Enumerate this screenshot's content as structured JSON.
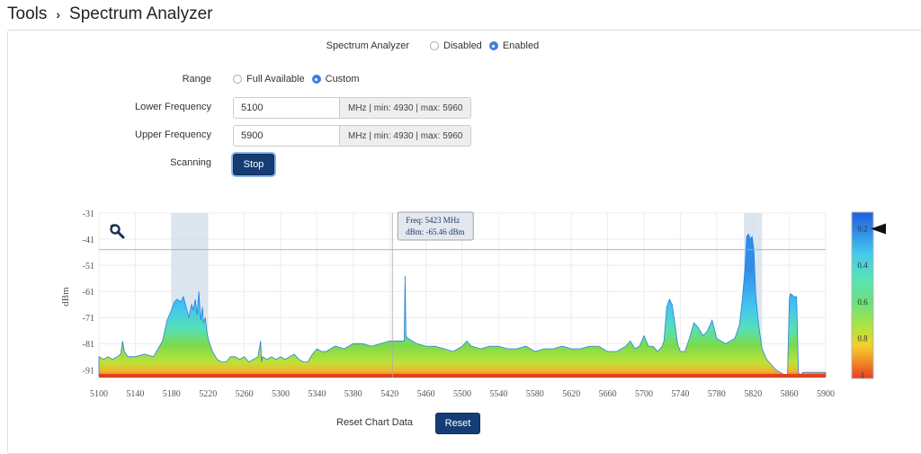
{
  "breadcrumb": {
    "root": "Tools",
    "current": "Spectrum Analyzer"
  },
  "form": {
    "analyzer": {
      "label": "Spectrum Analyzer",
      "options": [
        "Disabled",
        "Enabled"
      ],
      "selected": "Enabled"
    },
    "range": {
      "label": "Range",
      "options": [
        "Full Available",
        "Custom"
      ],
      "selected": "Custom"
    },
    "lower": {
      "label": "Lower Frequency",
      "value": "5100",
      "addon": "MHz | min: 4930 | max: 5960"
    },
    "upper": {
      "label": "Upper Frequency",
      "value": "5900",
      "addon": "MHz | min: 4930 | max: 5960"
    },
    "scanning": {
      "label": "Scanning",
      "button": "Stop"
    }
  },
  "chart_data": {
    "type": "area",
    "ylabel": "dBm",
    "xlim": [
      5100,
      5900
    ],
    "ylim": [
      -94,
      -31
    ],
    "x_ticks": [
      5100,
      5140,
      5180,
      5220,
      5260,
      5300,
      5340,
      5380,
      5420,
      5460,
      5500,
      5540,
      5580,
      5620,
      5660,
      5700,
      5740,
      5780,
      5820,
      5860,
      5900
    ],
    "y_ticks": [
      -31,
      -41,
      -51,
      -61,
      -71,
      -81,
      -91
    ],
    "tooltip": {
      "freq": "Freq: 5423 MHz",
      "dbm": "dBm: -65.46 dBm"
    },
    "crosshair": {
      "x": 5423,
      "y": -45
    },
    "highlight_bands": [
      [
        5180,
        5220
      ],
      [
        5810,
        5830
      ]
    ],
    "series": [
      {
        "x": [
          5100,
          5105,
          5110,
          5115,
          5120,
          5124,
          5126,
          5128,
          5132,
          5140,
          5150,
          5160,
          5170,
          5175,
          5180,
          5183,
          5186,
          5190,
          5193,
          5196,
          5199,
          5202,
          5204,
          5206,
          5208,
          5210,
          5212,
          5214,
          5215,
          5217,
          5219,
          5221,
          5223,
          5225,
          5230,
          5235,
          5240,
          5245,
          5250,
          5255,
          5260,
          5265,
          5270,
          5275,
          5278,
          5279,
          5280,
          5285,
          5290,
          5295,
          5300,
          5305,
          5310,
          5315,
          5320,
          5325,
          5330,
          5335,
          5340,
          5345,
          5350,
          5360,
          5370,
          5380,
          5390,
          5400,
          5410,
          5420,
          5430,
          5436,
          5437,
          5438,
          5440,
          5445,
          5450,
          5460,
          5470,
          5480,
          5490,
          5495,
          5500,
          5505,
          5510,
          5520,
          5530,
          5540,
          5550,
          5560,
          5570,
          5580,
          5590,
          5600,
          5610,
          5620,
          5630,
          5640,
          5650,
          5660,
          5670,
          5680,
          5685,
          5690,
          5695,
          5700,
          5705,
          5710,
          5715,
          5720,
          5722,
          5725,
          5728,
          5731,
          5734,
          5737,
          5740,
          5745,
          5750,
          5755,
          5760,
          5765,
          5770,
          5775,
          5780,
          5785,
          5790,
          5795,
          5800,
          5805,
          5808,
          5811,
          5813,
          5815,
          5817,
          5819,
          5821,
          5823,
          5825,
          5827,
          5830,
          5835,
          5840,
          5845,
          5850,
          5855,
          5858,
          5860,
          5861,
          5862,
          5865,
          5868,
          5870,
          5872,
          5875,
          5880,
          5885,
          5890,
          5900
        ],
        "y": [
          -86,
          -87,
          -86,
          -87,
          -86,
          -85,
          -80,
          -84,
          -86,
          -86,
          -85,
          -86,
          -80,
          -72,
          -68,
          -65,
          -64,
          -65,
          -63,
          -67,
          -71,
          -66,
          -68,
          -64,
          -70,
          -61,
          -72,
          -67,
          -73,
          -71,
          -77,
          -80,
          -82,
          -84,
          -87,
          -88,
          -88,
          -86,
          -86,
          -87,
          -86,
          -88,
          -87,
          -86,
          -80,
          -88,
          -86,
          -87,
          -86,
          -87,
          -86,
          -87,
          -86,
          -85,
          -87,
          -88,
          -88,
          -85,
          -83,
          -84,
          -84,
          -82,
          -83,
          -81,
          -81,
          -82,
          -81,
          -80,
          -80,
          -80,
          -55,
          -78,
          -79,
          -80,
          -81,
          -82,
          -82,
          -83,
          -84,
          -83,
          -82,
          -80,
          -82,
          -83,
          -82,
          -82,
          -83,
          -83,
          -82,
          -84,
          -83,
          -83,
          -82,
          -83,
          -83,
          -82,
          -82,
          -84,
          -84,
          -82,
          -80,
          -83,
          -82,
          -78,
          -82,
          -82,
          -84,
          -82,
          -80,
          -67,
          -64,
          -66,
          -73,
          -81,
          -84,
          -84,
          -79,
          -73,
          -75,
          -78,
          -76,
          -72,
          -79,
          -80,
          -81,
          -80,
          -79,
          -74,
          -65,
          -53,
          -40,
          -39,
          -41,
          -40,
          -45,
          -62,
          -70,
          -76,
          -83,
          -87,
          -89,
          -91,
          -92,
          -93,
          -93,
          -64,
          -62,
          -62,
          -63,
          -63,
          -92,
          -93,
          -92,
          -92,
          -92,
          -92,
          -92
        ]
      }
    ],
    "colorbar": {
      "labels": [
        "0.2",
        "0.4",
        "0.6",
        "0.8",
        "1"
      ],
      "marker": 0.2
    }
  },
  "footer": {
    "reset_label": "Reset Chart Data",
    "reset_button": "Reset"
  },
  "colors": {
    "button": "#153d75",
    "radio_on": "#3b82e0"
  },
  "icons": {
    "zoom": "zoom-icon",
    "chevron": "chevron-right-icon"
  }
}
